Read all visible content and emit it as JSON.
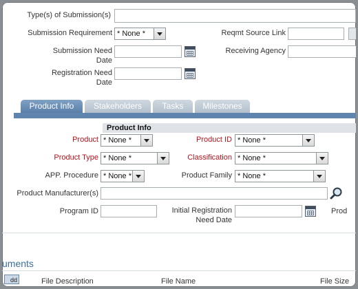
{
  "top_form": {
    "types_label": "Type(s) of Submission(s)",
    "sub_req_label": "Submission Requirement",
    "sub_req_value": "* None *",
    "reqmt_source_label": "Reqmt Source Link",
    "need_date_label_1": "Submission Need",
    "need_date_label_2": "Date",
    "receiving_agency_label": "Receiving Agency",
    "reg_need_label_1": "Registration Need",
    "reg_need_label_2": "Date"
  },
  "tabs": [
    {
      "label": "Product Info",
      "active": true
    },
    {
      "label": "Stakeholders",
      "active": false
    },
    {
      "label": "Tasks",
      "active": false
    },
    {
      "label": "Milestones",
      "active": false
    }
  ],
  "product_info": {
    "section_title": "Product Info",
    "product_label": "Product",
    "product_value": "* None *",
    "product_id_label": "Product ID",
    "product_id_value": "* None *",
    "product_type_label": "Product Type",
    "product_type_value": "* None *",
    "classification_label": "Classification",
    "classification_value": "* None *",
    "app_procedure_label": "APP. Procedure",
    "app_procedure_value": "* None *",
    "product_family_label": "Product Family",
    "product_family_value": "* None *",
    "manufacturer_label": "Product Manufacturer(s)",
    "program_id_label": "Program ID",
    "init_reg_label_1": "Initial Registration",
    "init_reg_label_2": "Need Date",
    "prod_cut_label": "Prod"
  },
  "attachments": {
    "section_title_partial": "uments",
    "add_label": "dd",
    "col_description": "File Description",
    "col_name": "File Name",
    "col_size": "File Size"
  },
  "colors": {
    "required_label": "#b5121b",
    "tab_active": "#5a7fa8",
    "tab_inactive": "#b3c0cc"
  }
}
